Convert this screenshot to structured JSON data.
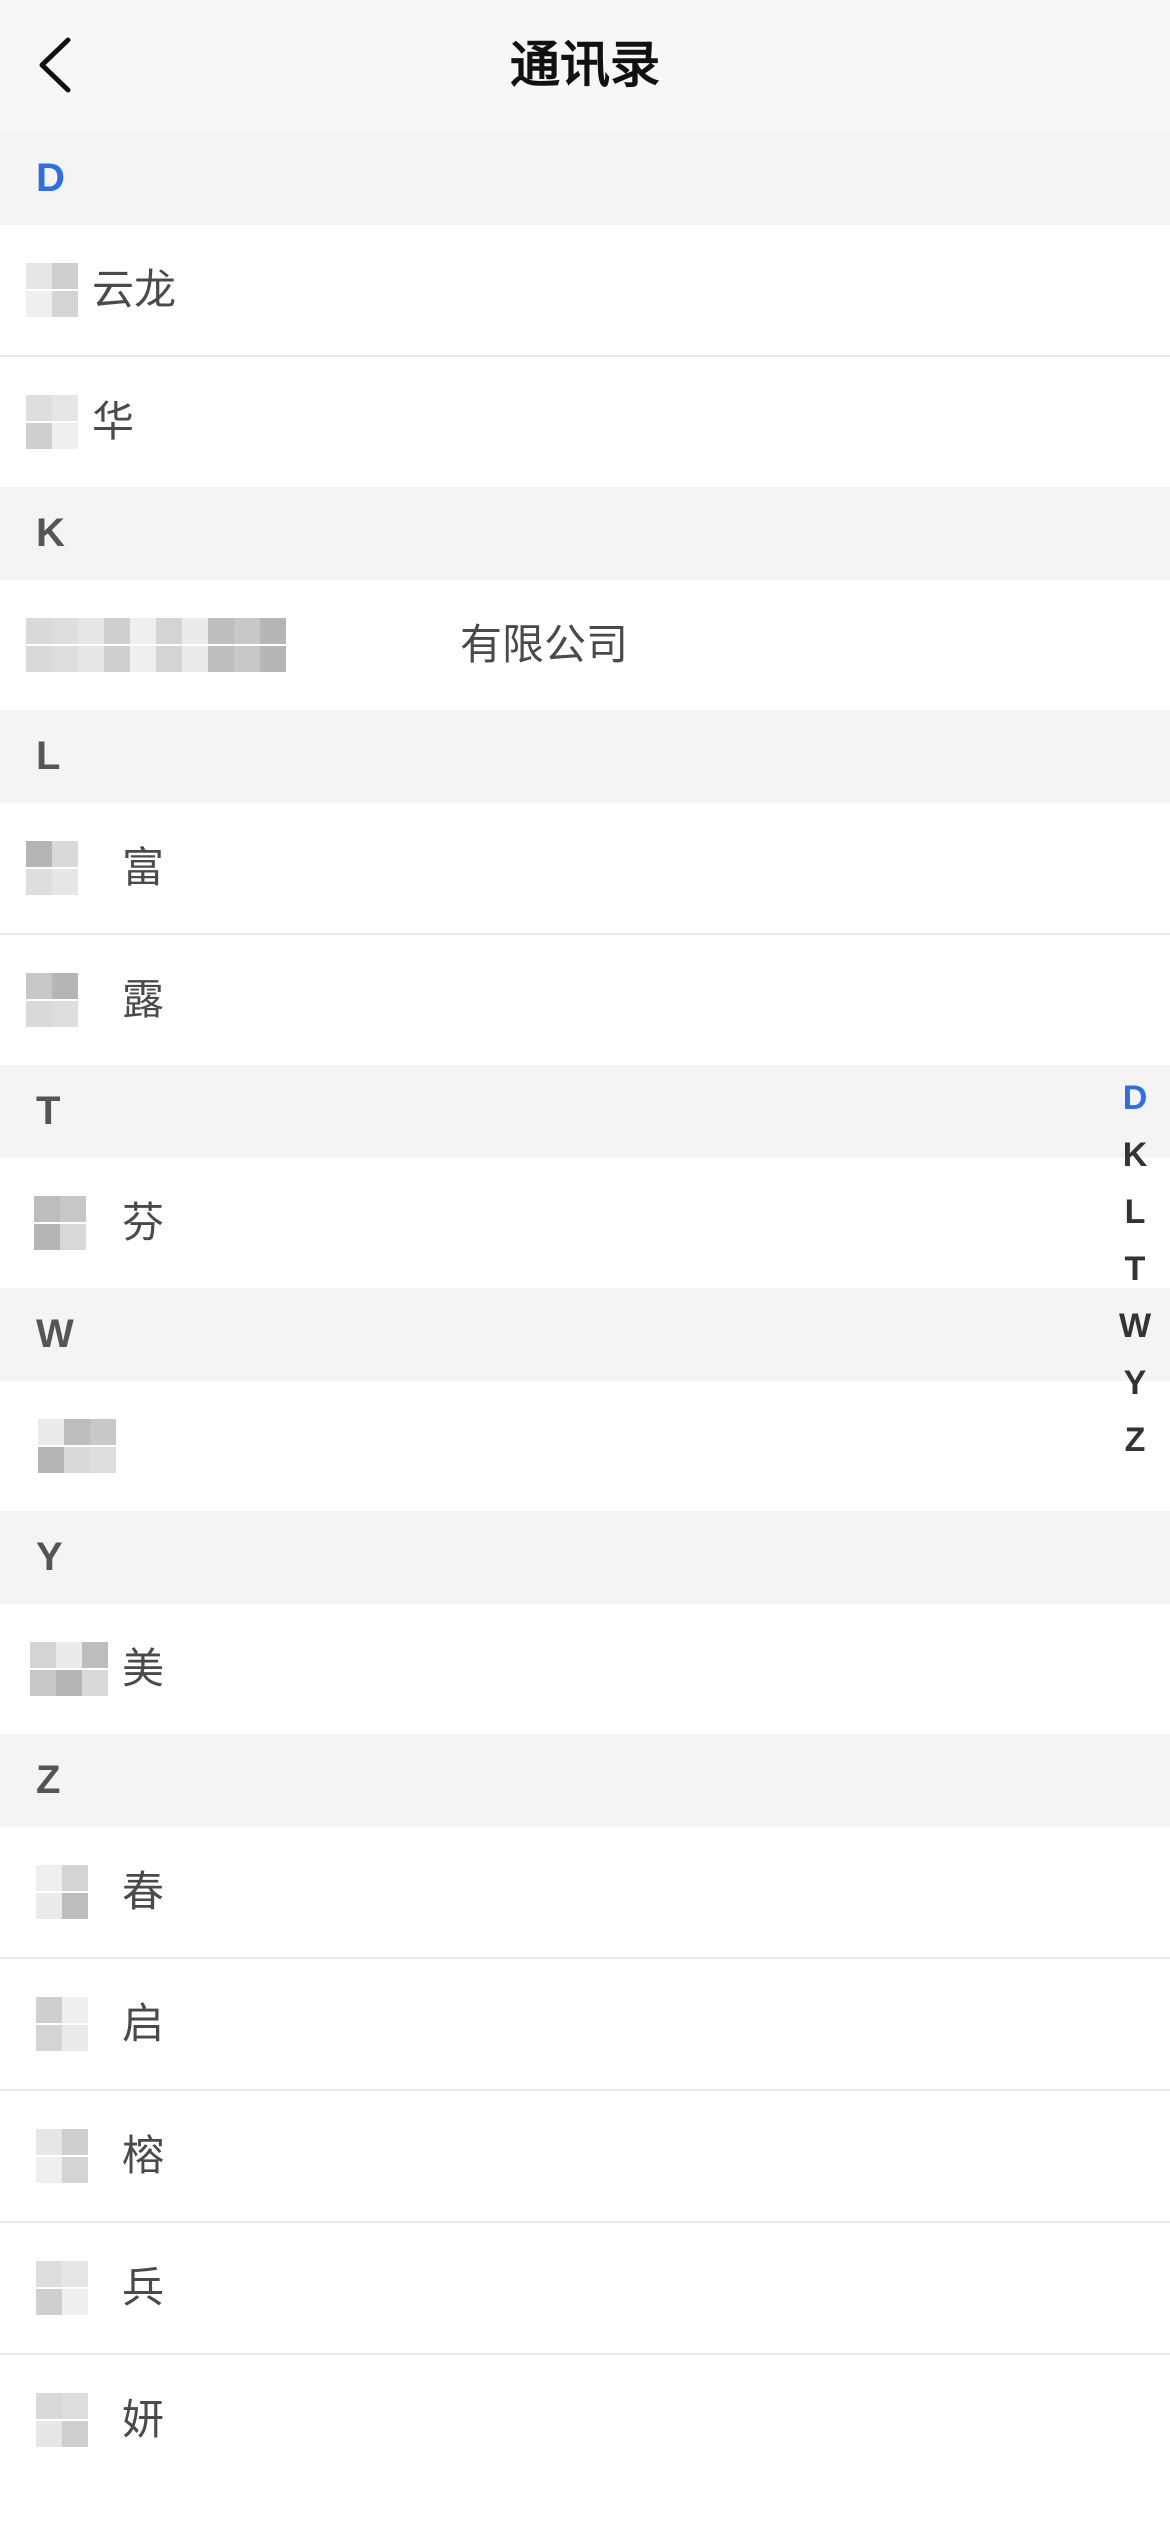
{
  "header": {
    "title": "通讯录",
    "back_icon": "chevron-left-icon"
  },
  "colors": {
    "accent": "#2f6fe5",
    "section_bg": "#f4f4f4",
    "header_bg": "#f7f7f7",
    "text": "#4a4a4a"
  },
  "sections": [
    {
      "letter": "D",
      "contacts": [
        {
          "visible_name": "云龙",
          "redacted": true
        },
        {
          "visible_name": "华",
          "redacted": true
        }
      ]
    },
    {
      "letter": "K",
      "contacts": [
        {
          "visible_name": "有限公司",
          "redacted": true
        }
      ]
    },
    {
      "letter": "L",
      "contacts": [
        {
          "visible_name": "富",
          "redacted": true
        },
        {
          "visible_name": "露",
          "redacted": true
        }
      ]
    },
    {
      "letter": "T",
      "contacts": [
        {
          "visible_name": "芬",
          "redacted": true
        }
      ]
    },
    {
      "letter": "W",
      "contacts": [
        {
          "visible_name": "",
          "redacted": true
        }
      ]
    },
    {
      "letter": "Y",
      "contacts": [
        {
          "visible_name": "美",
          "redacted": true
        }
      ]
    },
    {
      "letter": "Z",
      "contacts": [
        {
          "visible_name": "春",
          "redacted": true
        },
        {
          "visible_name": "启",
          "redacted": true
        },
        {
          "visible_name": "榕",
          "redacted": true
        },
        {
          "visible_name": "兵",
          "redacted": true
        },
        {
          "visible_name": "妍",
          "redacted": true
        }
      ]
    }
  ],
  "index_bar": {
    "letters": [
      "D",
      "K",
      "L",
      "T",
      "W",
      "Y",
      "Z"
    ],
    "active": "D"
  }
}
